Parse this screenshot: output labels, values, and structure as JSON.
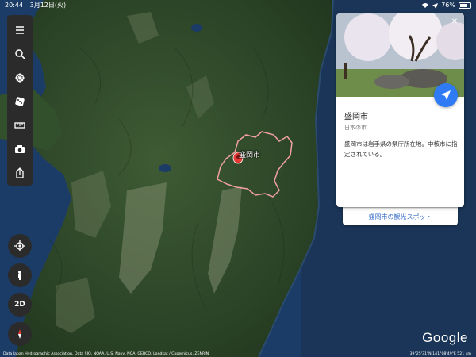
{
  "status_bar": {
    "time": "20:44",
    "date": "3月12日(火)",
    "battery_percent": "76%",
    "battery_level": 0.76
  },
  "toolbar": {
    "items": [
      {
        "icon": "menu-icon"
      },
      {
        "icon": "search-icon"
      },
      {
        "icon": "voyager-icon"
      },
      {
        "icon": "dice-icon"
      },
      {
        "icon": "ruler-icon"
      },
      {
        "icon": "camera-icon"
      },
      {
        "icon": "share-icon"
      }
    ]
  },
  "map_controls": {
    "location_icon": "my-location-icon",
    "streetview_icon": "pegman-icon",
    "view_mode_label": "2D",
    "compass_icon": "compass-icon"
  },
  "map": {
    "place_label": "盛岡市",
    "boundary_color": "#f2a0a0",
    "pin_color": "#e53935"
  },
  "info_card": {
    "title": "盛岡市",
    "subtitle": "日本の市",
    "description": "盛岡市は岩手県の県庁所在地。中核市に指定されている。",
    "close_label": "✕",
    "accent_color": "#2f7bf6"
  },
  "secondary_card": {
    "link_label": "盛岡市の観光スポット"
  },
  "footer": {
    "attribution": "Data Japan Hydrographic Association, Data SIO, NOAA, U.S. Navy, NGA, GEBCO, Landsat / Copernicus, ZENRIN",
    "coordinates": "39°25'31\"N 141°08'49\"E 521 km",
    "logo_text": "Google"
  }
}
